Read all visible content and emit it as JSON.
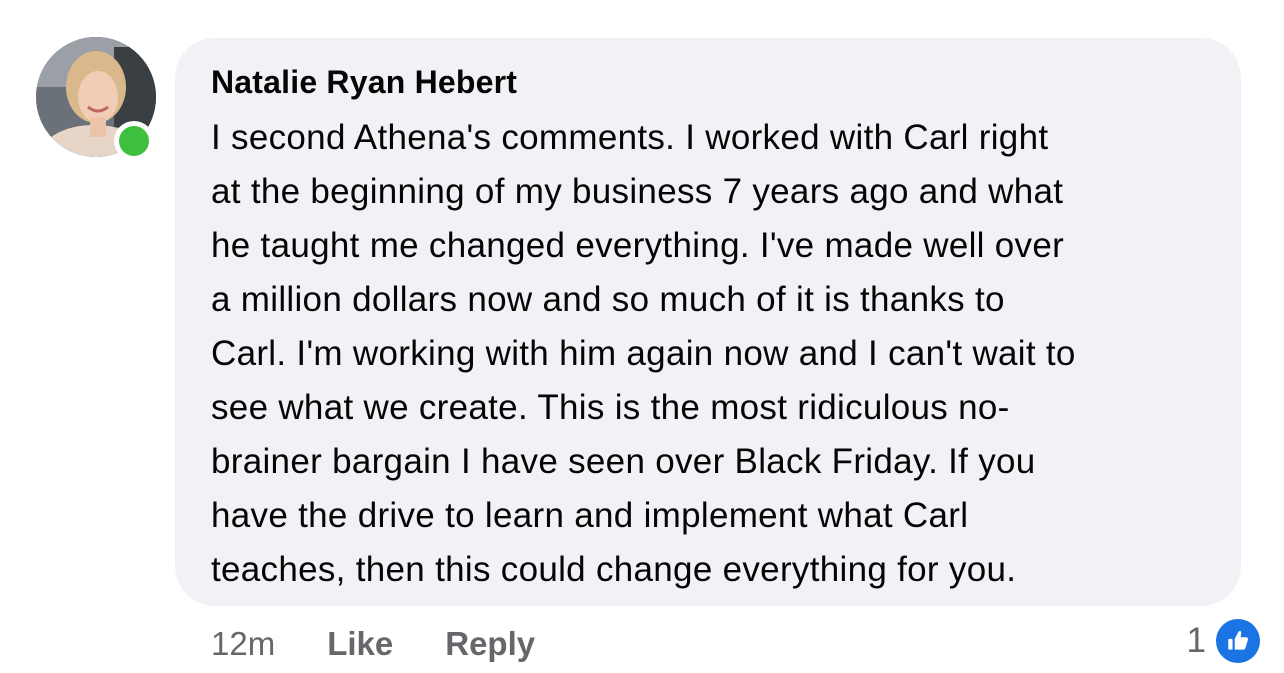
{
  "comment": {
    "author": "Natalie Ryan Hebert",
    "lines": [
      "I second Athena's comments. I worked with Carl right",
      "at the beginning of my business 7 years ago and what",
      "he taught me changed everything. I've made well over",
      "a million dollars now and so much of it is thanks to",
      "Carl. I'm working with him again now and I can't wait to",
      "see what we create. This is the most ridiculous no-",
      "brainer bargain I have seen over Black Friday. If you",
      "have the drive to learn and implement what Carl",
      "teaches, then this could change everything for you."
    ],
    "online": true
  },
  "actions": {
    "time": "12m",
    "like_label": "Like",
    "reply_label": "Reply"
  },
  "reactions": {
    "count": "1",
    "icon": "thumbs-up-icon"
  },
  "colors": {
    "bubble": "#f0f2f5",
    "text": "#050505",
    "muted": "#65676b",
    "online": "#3ec03e",
    "like_blue": "#1b74e4"
  }
}
